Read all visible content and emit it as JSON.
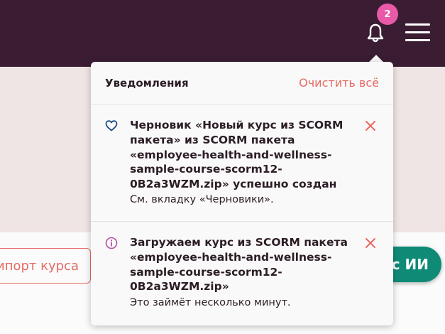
{
  "header": {
    "notification_count": "2",
    "icons": [
      "bell-icon",
      "hamburger-menu-icon"
    ]
  },
  "background": {
    "import_label": "ипорт курса",
    "ai_label": "с ИИ"
  },
  "notifications": {
    "title": "Уведомления",
    "clear_all": "Очистить всё",
    "items": [
      {
        "icon": "heart-icon",
        "title_lines": [
          "Черновик «Новый курс из SCORM",
          "пакета» из SCORM пакета",
          "«employee-health-and-wellness-",
          "sample-course-scorm12-",
          "0B2a3WZM.zip» успешно создан"
        ],
        "body": "См. вкладку «Черновики»."
      },
      {
        "icon": "info-icon",
        "title_lines": [
          "Загружаем курс из SCORM пакета",
          "«employee-health-and-wellness-",
          "sample-course-scorm12-",
          "0B2a3WZM.zip»"
        ],
        "body": "Это займёт несколько минут."
      }
    ]
  },
  "colors": {
    "topbar": "#3b1d33",
    "accent": "#e76a63",
    "badge": "#e85aa7",
    "teal": "#0f8a77"
  }
}
